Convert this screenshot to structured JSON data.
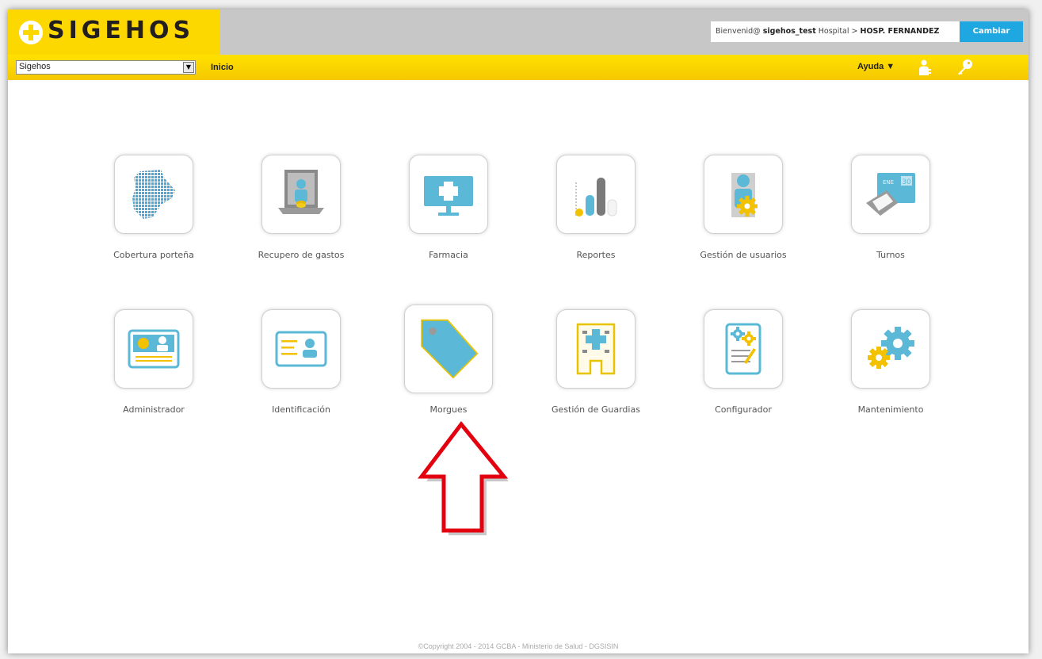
{
  "header": {
    "logo_text": "SIGEHOS",
    "welcome_prefix": "Bienvenid@ ",
    "username": "sigehos_test",
    "hospital_label": " Hospital > ",
    "hospital_name": "HOSP. FERNANDEZ",
    "change_button": "Cambiar"
  },
  "nav": {
    "system_select_value": "Sigehos",
    "home_link": "Inicio",
    "help_menu": "Ayuda ▼",
    "icons": [
      "user-icon",
      "key-icon"
    ]
  },
  "modules": [
    {
      "label": "Cobertura porteña",
      "icon": "city-map-icon"
    },
    {
      "label": "Recupero de gastos",
      "icon": "cashier-icon"
    },
    {
      "label": "Farmacia",
      "icon": "pharmacy-monitor-icon"
    },
    {
      "label": "Reportes",
      "icon": "bar-chart-icon"
    },
    {
      "label": "Gestión de usuarios",
      "icon": "user-gear-icon"
    },
    {
      "label": "Turnos",
      "icon": "calendar-printer-icon"
    },
    {
      "label": "Administrador",
      "icon": "admin-card-icon"
    },
    {
      "label": "Identificación",
      "icon": "id-card-icon"
    },
    {
      "label": "Morgues",
      "icon": "tag-icon"
    },
    {
      "label": "Gestión de Guardias",
      "icon": "hospital-building-icon"
    },
    {
      "label": "Configurador",
      "icon": "config-document-icon"
    },
    {
      "label": "Mantenimiento",
      "icon": "gears-icon"
    }
  ],
  "footer": "©Copyright 2004 - 2014 GCBA - Ministerio de Salud - DGSISIN",
  "colors": {
    "brand_yellow": "#fdd800",
    "accent_blue": "#1ea7e1",
    "icon_blue": "#5bb8d6",
    "icon_gray": "#8a8a8a",
    "arrow_red": "#e3000f"
  }
}
